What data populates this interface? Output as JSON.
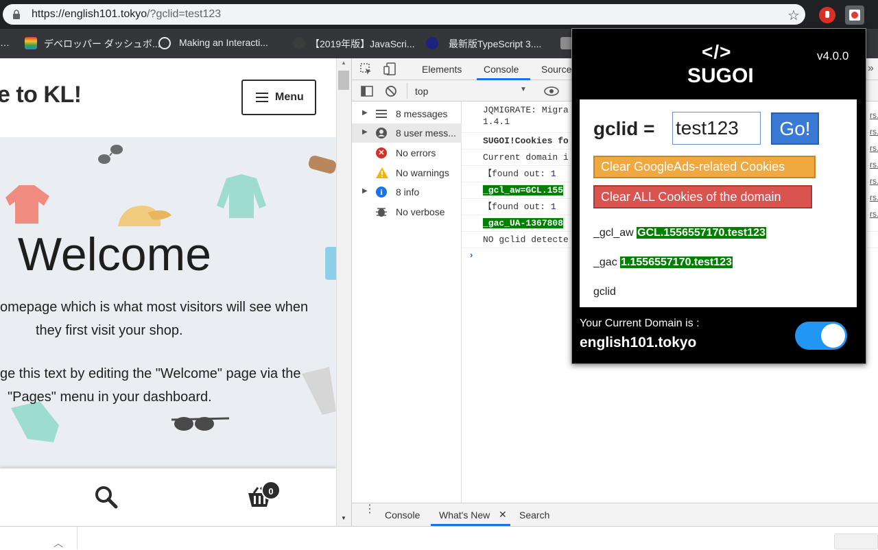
{
  "browser": {
    "url_host": "https://english101.tokyo",
    "url_path": "/?gclid=test123",
    "bookmarks": [
      {
        "label": "デベロッパー ダッシュボ..."
      },
      {
        "label": "Making an Interacti..."
      },
      {
        "label": "【2019年版】JavaScri..."
      },
      {
        "label": "最新版TypeScript 3...."
      }
    ]
  },
  "site": {
    "title": "e to KL!",
    "menu_label": "Menu",
    "hero_title": "Welcome",
    "hero_line1": "omepage which is what most visitors will see when",
    "hero_line2": "they first visit your shop.",
    "hero_line3": "ge this text by editing the \"Welcome\" page via the",
    "hero_line4": "\"Pages\" menu in your dashboard.",
    "cart_count": "0"
  },
  "devtools": {
    "tabs": [
      "Elements",
      "Console",
      "Source"
    ],
    "context": "top",
    "sidebar": [
      {
        "label": "8 messages",
        "expandable": true
      },
      {
        "label": "8 user mess...",
        "expandable": true
      },
      {
        "label": "No errors",
        "expandable": false
      },
      {
        "label": "No warnings",
        "expandable": false
      },
      {
        "label": "8 info",
        "expandable": true
      },
      {
        "label": "No verbose",
        "expandable": false
      }
    ],
    "console": {
      "l1a": "JQMIGRATE: Migra",
      "l1b": "1.4.1",
      "l2": "SUGOI!Cookies fo",
      "l3": "Current domain i",
      "l4a": "【found out: ",
      "l4b": "1",
      "l5": "_gcl_aw=GCL.155",
      "l6a": "【found out: ",
      "l6b": "1",
      "l7": "_gac_UA-1367808",
      "l8": "NO gclid detecte"
    },
    "bottom_tabs": [
      "Console",
      "What's New",
      "Search"
    ],
    "source_links": [
      "rs.",
      "rs.",
      "rs.",
      "rs.",
      "rs.",
      "rs.",
      "rs."
    ]
  },
  "popup": {
    "logo_code": "</>",
    "logo_name": "SUGOI",
    "version": "v4.0.0",
    "gclid_label": "gclid =",
    "gclid_value": "test123",
    "go_label": "Go!",
    "clear_ga_label": "Clear GoogleAds-related Cookies",
    "clear_all_label": "Clear ALL Cookies of the domain",
    "gcl_aw_key": "_gcl_aw",
    "gcl_aw_value": "GCL.1556557170.test123",
    "gac_key": "_gac",
    "gac_value": "1.1556557170.test123",
    "gclid_key": "gclid",
    "domain_caption": "Your Current Domain is :",
    "domain_value": "english101.tokyo",
    "toggle_on": true
  }
}
